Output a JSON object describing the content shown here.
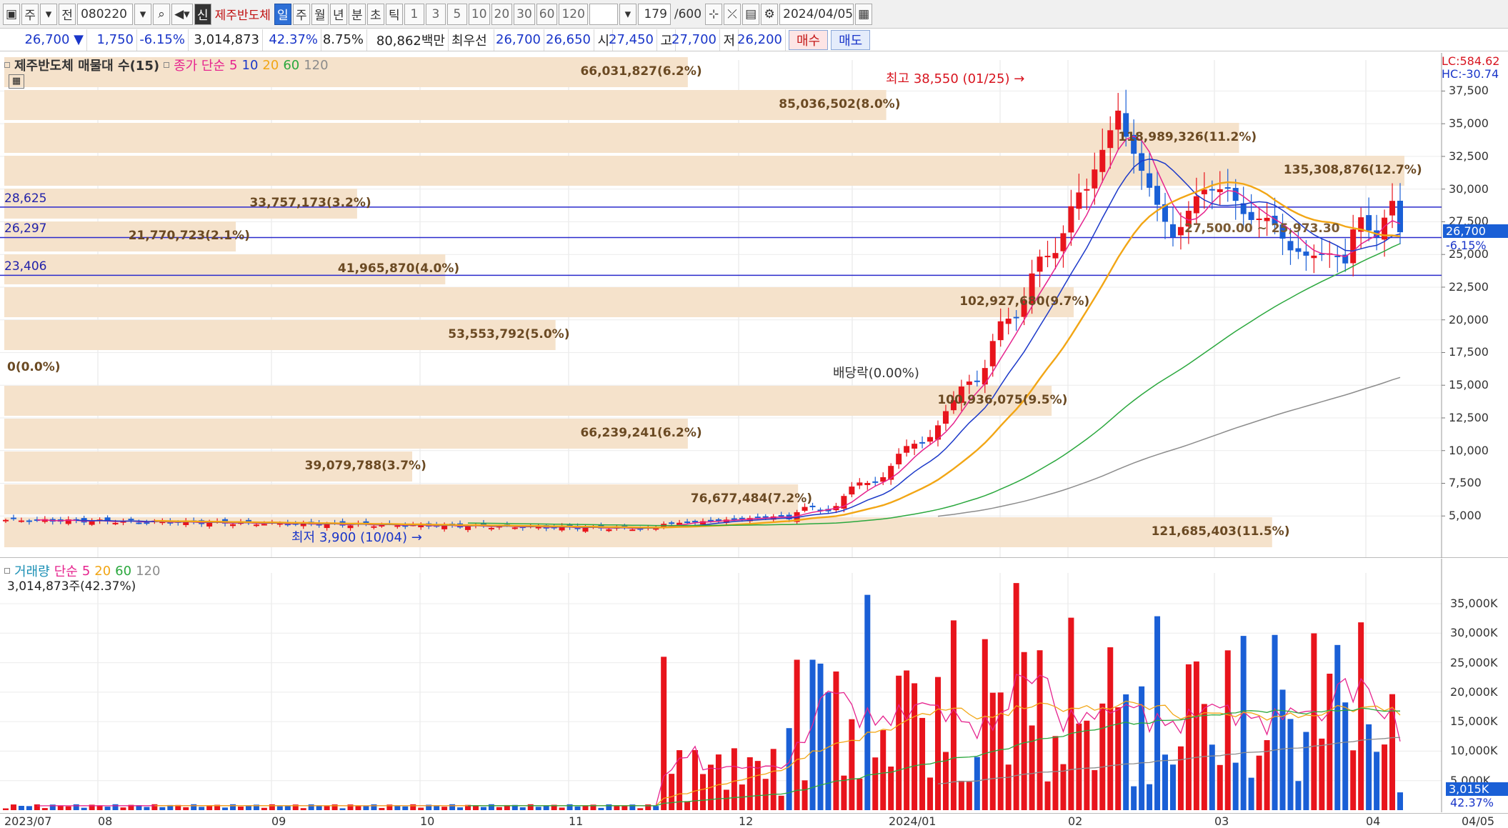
{
  "toolbar": {
    "mode_label": "주",
    "prev_label": "전",
    "stock_code": "080220",
    "new_badge": "신",
    "stock_name": "제주반도체",
    "periods": [
      "일",
      "주",
      "월",
      "년",
      "분",
      "초",
      "틱"
    ],
    "active_period": "일",
    "intervals": [
      "1",
      "3",
      "5",
      "10",
      "20",
      "30",
      "60",
      "120"
    ],
    "count": "179",
    "count_max": "/600",
    "date": "2024/04/05"
  },
  "quote": {
    "price": "26,700 ▼",
    "change": "1,750",
    "change_pct": "-6.15%",
    "volume": "3,014,873",
    "volume_ratio": "42.37%",
    "turnover": "8.75%",
    "amount": "80,862백만",
    "prior_label": "최우선",
    "ask": "26,700",
    "bid": "26,650",
    "open_label": "시",
    "open": "27,450",
    "high_label": "고",
    "high": "27,700",
    "low_label": "저",
    "low": "26,200",
    "buy_label": "매수",
    "sell_label": "매도"
  },
  "price_panel": {
    "title": "제주반도체 매물대 수(15)",
    "ma_title": "종가 단순",
    "ma_periods": [
      "5",
      "10",
      "20",
      "60",
      "120"
    ],
    "lc": "LC:584.62",
    "hc": "HC:-30.74",
    "current_price_tag": "26,700",
    "current_pct_tag": "-6.15%",
    "high_annotation": "최고 38,550 (01/25)",
    "low_annotation": "최저 3,900 (10/04)",
    "dividend_annotation": "배당락(0.00%)",
    "hlines": [
      {
        "label": "28,625",
        "value": 28625
      },
      {
        "label": "26,297",
        "value": 26297
      },
      {
        "label": "23,406",
        "value": 23406
      }
    ],
    "y_ticks": [
      "37,500",
      "35,000",
      "32,500",
      "30,000",
      "27,500",
      "25,000",
      "22,500",
      "20,000",
      "17,500",
      "15,000",
      "12,500",
      "10,000",
      "7,500",
      "5,000"
    ],
    "volume_profile": [
      {
        "label": "121,685,403(11.5%)",
        "pct": 11.5
      },
      {
        "label": "76,677,484(7.2%)",
        "pct": 7.2
      },
      {
        "label": "39,079,788(3.7%)",
        "pct": 3.7
      },
      {
        "label": "66,239,241(6.2%)",
        "pct": 6.2
      },
      {
        "label": "100,936,075(9.5%)",
        "pct": 9.5
      },
      {
        "label": "0(0.0%)",
        "pct": 0.0
      },
      {
        "label": "53,553,792(5.0%)",
        "pct": 5.0
      },
      {
        "label": "102,927,680(9.7%)",
        "pct": 9.7
      },
      {
        "label": "41,965,870(4.0%)",
        "pct": 4.0
      },
      {
        "label": "21,770,723(2.1%)",
        "pct": 2.1
      },
      {
        "label": "33,757,173(3.2%)",
        "pct": 3.2
      },
      {
        "label": "135,308,876(12.7%)",
        "pct": 12.7
      },
      {
        "label": "118,989,326(11.2%)",
        "pct": 11.2
      },
      {
        "label": "85,036,502(8.0%)",
        "pct": 8.0
      },
      {
        "label": "66,031,827(6.2%)",
        "pct": 6.2
      }
    ],
    "range_annotation": "27,500.00 ~ 25,973.30"
  },
  "volume_panel": {
    "title": "거래량",
    "ma_title": "단순",
    "ma_periods": [
      "5",
      "20",
      "60",
      "120"
    ],
    "summary": "3,014,873주(42.37%)",
    "y_ticks": [
      "35,000K",
      "30,000K",
      "25,000K",
      "20,000K",
      "15,000K",
      "10,000K",
      "5,000K"
    ],
    "current_tag": "3,015K",
    "current_pct_tag": "42.37%"
  },
  "x_labels": [
    "2023/07",
    "08",
    "09",
    "10",
    "11",
    "12",
    "2024/01",
    "02",
    "03",
    "04",
    "04/05"
  ],
  "colors": {
    "up": "#e8141c",
    "down": "#1a5fd6",
    "ma5": "#e6238e",
    "ma10": "#1c39c9",
    "ma20": "#f2a615",
    "ma60": "#2ba83e",
    "ma120": "#8c8c8c",
    "profile": "#f5e2cb"
  }
}
